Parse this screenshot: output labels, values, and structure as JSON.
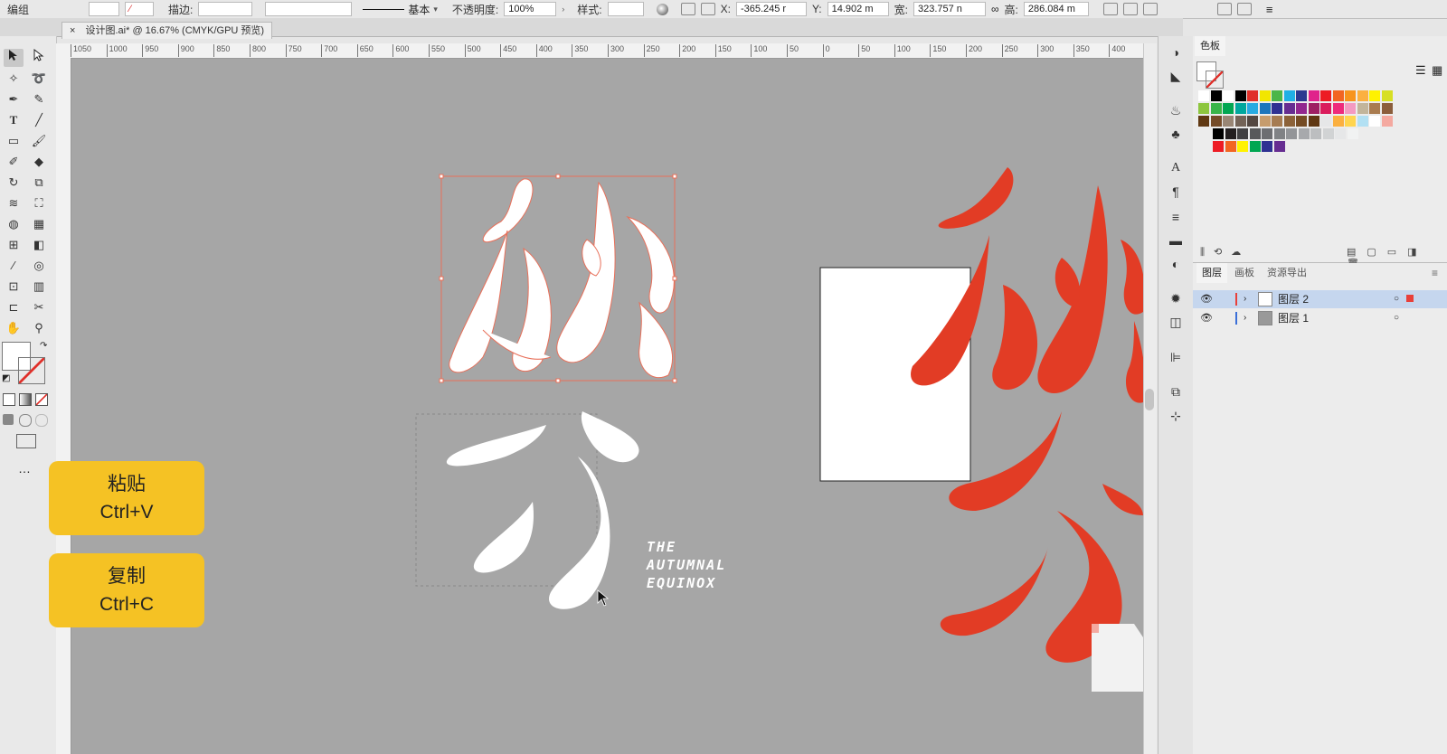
{
  "control_bar": {
    "mode_label": "编组",
    "stroke_label": "描边:",
    "stroke_style": "基本",
    "opacity_label": "不透明度:",
    "opacity_value": "100%",
    "style_label": "样式:",
    "x_label": "X:",
    "x_value": "-365.245 r",
    "y_label": "Y:",
    "y_value": "14.902 m",
    "width_label": "宽:",
    "width_value": "323.757 n",
    "height_label": "高:",
    "height_value": "286.084 m"
  },
  "document_tab": {
    "close_glyph": "×",
    "title": "设计图.ai* @ 16.67% (CMYK/GPU 预览)"
  },
  "ruler": {
    "labels": [
      "1050",
      "1000",
      "950",
      "900",
      "850",
      "800",
      "750",
      "700",
      "650",
      "600",
      "550",
      "500",
      "450",
      "400",
      "350",
      "300",
      "250",
      "200",
      "150",
      "100",
      "50",
      "0",
      "50",
      "100",
      "150",
      "200",
      "250",
      "300",
      "350",
      "400"
    ]
  },
  "artwork": {
    "tagline_line1": "THE",
    "tagline_line2": "AUTUMNAL",
    "tagline_line3": "EQUINOX"
  },
  "overlays": {
    "paste_title": "粘贴",
    "paste_shortcut": "Ctrl+V",
    "copy_title": "复制",
    "copy_shortcut": "Ctrl+C"
  },
  "swatches_panel": {
    "title": "色板"
  },
  "layers_panel": {
    "tabs": [
      "图层",
      "画板",
      "资源导出"
    ],
    "layers": [
      {
        "name": "图层 2",
        "selected": true,
        "color": "#e8403a"
      },
      {
        "name": "图层 1",
        "selected": false,
        "color": "#3a6fd8"
      }
    ]
  },
  "colors": {
    "canvas": "#a6a6a6",
    "accent_red": "#e23c25",
    "callout_yellow": "#f5c224",
    "selection": "#e8705a"
  },
  "toolbar": {
    "more_glyph": "…"
  }
}
